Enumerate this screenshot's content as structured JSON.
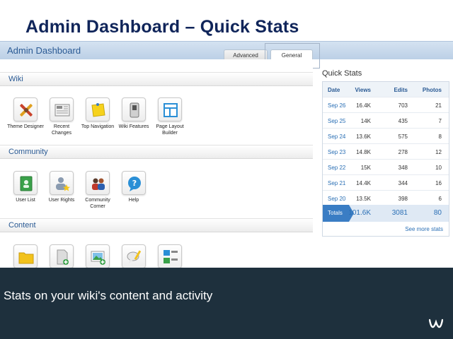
{
  "slide": {
    "title": "Admin Dashboard – Quick Stats",
    "caption": "Stats on your wiki's content and activity"
  },
  "header": {
    "title": "Admin Dashboard",
    "tabs": [
      {
        "label": "Advanced",
        "active": false
      },
      {
        "label": "General",
        "active": true
      }
    ]
  },
  "sections": {
    "wiki": {
      "label": "Wiki",
      "tools": [
        {
          "label": "Theme Designer",
          "icon": "paintbrush-icon"
        },
        {
          "label": "Recent Changes",
          "icon": "newspaper-icon"
        },
        {
          "label": "Top Navigation",
          "icon": "sticky-note-icon"
        },
        {
          "label": "Wiki Features",
          "icon": "switch-icon"
        },
        {
          "label": "Page Layout Builder",
          "icon": "layout-icon"
        }
      ]
    },
    "community": {
      "label": "Community",
      "tools": [
        {
          "label": "User List",
          "icon": "address-book-icon"
        },
        {
          "label": "User Rights",
          "icon": "user-star-icon"
        },
        {
          "label": "Community Corner",
          "icon": "users-icon"
        },
        {
          "label": "Help",
          "icon": "help-bubble-icon"
        }
      ]
    },
    "content": {
      "label": "Content",
      "tools": [
        {
          "label": "",
          "icon": "folder-icon"
        },
        {
          "label": "",
          "icon": "add-page-icon"
        },
        {
          "label": "",
          "icon": "add-image-icon"
        },
        {
          "label": "",
          "icon": "speech-pencil-icon"
        },
        {
          "label": "",
          "icon": "category-icon"
        }
      ]
    }
  },
  "quick_stats": {
    "title": "Quick Stats",
    "columns": [
      "Date",
      "Views",
      "Edits",
      "Photos"
    ],
    "rows": [
      {
        "date": "Sep 26",
        "views": "16.4K",
        "edits": "703",
        "photos": "21"
      },
      {
        "date": "Sep 25",
        "views": "14K",
        "edits": "435",
        "photos": "7"
      },
      {
        "date": "Sep 24",
        "views": "13.6K",
        "edits": "575",
        "photos": "8"
      },
      {
        "date": "Sep 23",
        "views": "14.8K",
        "edits": "278",
        "photos": "12"
      },
      {
        "date": "Sep 22",
        "views": "15K",
        "edits": "348",
        "photos": "10"
      },
      {
        "date": "Sep 21",
        "views": "14.4K",
        "edits": "344",
        "photos": "16"
      },
      {
        "date": "Sep 20",
        "views": "13.5K",
        "edits": "398",
        "photos": "6"
      }
    ],
    "totals": {
      "label": "Totals",
      "views": "101.6K",
      "edits": "3081",
      "photos": "80"
    },
    "see_more": "See more stats"
  },
  "colors": {
    "title": "#10255a",
    "accent": "#2a6fb5",
    "caption_bg": "#1e303d"
  }
}
